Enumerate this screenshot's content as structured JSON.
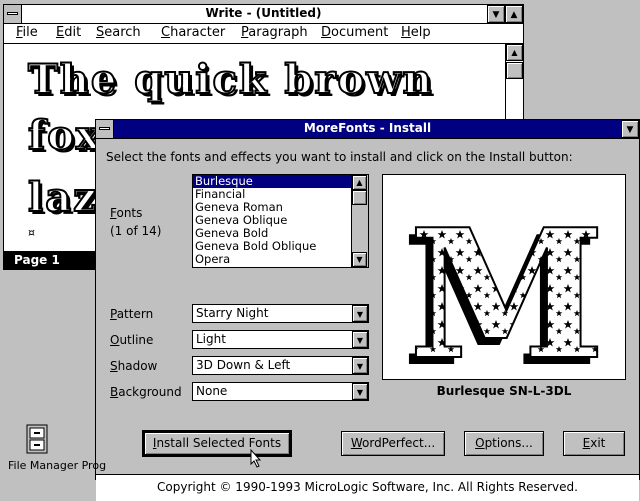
{
  "write": {
    "title": "Write - (Untitled)",
    "menu": [
      "File",
      "Edit",
      "Search",
      "Character",
      "Paragraph",
      "Document",
      "Help"
    ],
    "doc_lines": [
      "The quick brown",
      "fox",
      "laz"
    ],
    "status": "Page 1"
  },
  "morefonts": {
    "title": "MoreFonts - Install",
    "instruction": "Select the fonts and effects you want to install and click on the Install button:",
    "fonts_label": "Fonts",
    "fonts_count": "(1 of 14)",
    "fonts_list": [
      "Burlesque",
      "Financial",
      "Geneva Roman",
      "Geneva Oblique",
      "Geneva Bold",
      "Geneva Bold Oblique",
      "Opera"
    ],
    "selected_font": "Burlesque",
    "pattern_label": "Pattern",
    "pattern_value": "Starry Night",
    "outline_label": "Outline",
    "outline_value": "Light",
    "shadow_label": "Shadow",
    "shadow_value": "3D Down & Left",
    "background_label": "Background",
    "background_value": "None",
    "preview_letter": "M",
    "preview_caption": "Burlesque SN-L-3DL",
    "buttons": {
      "install": "Install Selected Fonts",
      "wordperfect": "WordPerfect...",
      "options": "Options...",
      "exit": "Exit"
    },
    "copyright": "Copyright © 1990-1993 MicroLogic Software, Inc.  All Rights Reserved."
  },
  "desktop": {
    "icon_label": "File Manager Prog"
  },
  "colors": {
    "desktop": "#c0c0c0",
    "active_title": "#000080",
    "selection": "#000080"
  }
}
